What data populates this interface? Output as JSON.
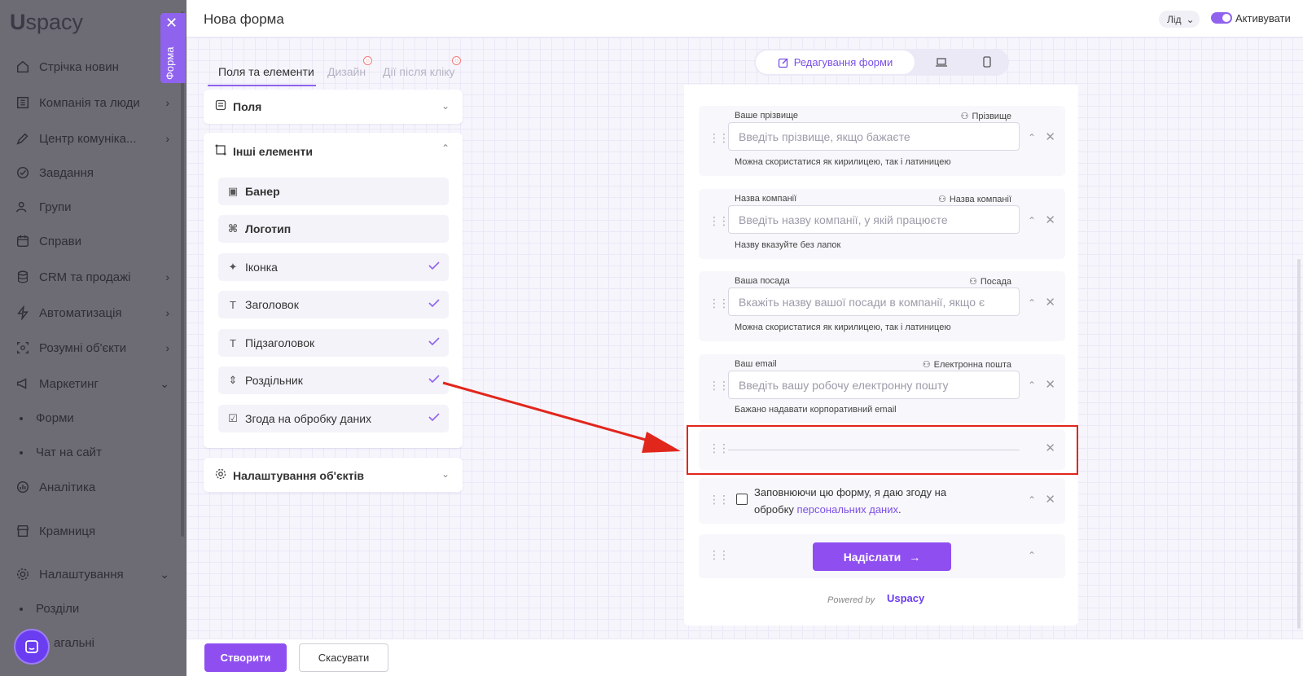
{
  "sidebar": {
    "logo_u": "U",
    "logo_rest": "spacy",
    "items": [
      {
        "label": "Стрічка новин",
        "icon": "home-icon"
      },
      {
        "label": "Компанія та люди",
        "icon": "building-icon"
      },
      {
        "label": "Центр комуніка...",
        "icon": "edit-icon"
      },
      {
        "label": "Завдання",
        "icon": "check-circle-icon"
      },
      {
        "label": "Групи",
        "icon": "users-icon"
      },
      {
        "label": "Справи",
        "icon": "calendar-icon"
      },
      {
        "label": "CRM та продажі",
        "icon": "database-icon"
      },
      {
        "label": "Автоматизація",
        "icon": "bolt-icon"
      },
      {
        "label": "Розумні об'єкти",
        "icon": "cube-icon"
      },
      {
        "label": "Маркетинг",
        "icon": "megaphone-icon"
      },
      {
        "label": "Аналітика",
        "icon": "chart-icon"
      },
      {
        "label": "Крамниця",
        "icon": "store-icon"
      },
      {
        "label": "Налаштування",
        "icon": "gear-icon"
      }
    ],
    "sub_items": [
      "Форми",
      "Чат на сайт",
      "Розділи",
      "агальні"
    ]
  },
  "forma_tab": {
    "label": "Форма"
  },
  "header": {
    "title": "Нова форма",
    "lead_select": "Лід",
    "activate_label": "Активувати"
  },
  "left_tabs": [
    "Поля та елементи",
    "Дизайн",
    "Дії після кліку"
  ],
  "panels": {
    "fields": "Поля",
    "other_elements": "Інші елементи",
    "object_settings": "Налаштування об'єктів"
  },
  "elements": [
    {
      "label": "Банер",
      "icon": "image-icon",
      "checked": false
    },
    {
      "label": "Логотип",
      "icon": "command-icon",
      "checked": false
    },
    {
      "label": "Іконка",
      "icon": "magic-wand-icon",
      "checked": true
    },
    {
      "label": "Заголовок",
      "icon": "text-icon",
      "checked": true
    },
    {
      "label": "Підзаголовок",
      "icon": "text-icon",
      "checked": true
    },
    {
      "label": "Роздільник",
      "icon": "divider-icon",
      "checked": true
    },
    {
      "label": "Згода на обробку даних",
      "icon": "checkbox-icon",
      "checked": true
    }
  ],
  "mode_switch": {
    "active_label": "Редагування форми"
  },
  "form_fields": [
    {
      "label": "Ваше прізвище",
      "map": "Прізвище",
      "placeholder": "Введіть прізвище, якщо бажаєте",
      "hint": "Можна скористатися як кирилицею, так і латиницею"
    },
    {
      "label": "Назва компанії",
      "map": "Назва компанії",
      "placeholder": "Введіть назву компанії, у якій працюєте",
      "hint": "Назву вказуйте без лапок"
    },
    {
      "label": "Ваша посада",
      "map": "Посада",
      "placeholder": "Вкажіть назву вашої посади в компанії, якщо є",
      "hint": "Можна скористатися як кирилицею, так і латиницею"
    },
    {
      "label": "Ваш email",
      "map": "Електронна пошта",
      "placeholder": "Введіть вашу робочу електронну пошту",
      "hint": "Бажано надавати корпоративний email"
    }
  ],
  "consent": {
    "text_before": "Заповнюючи цю форму, я даю згоду на обробку ",
    "link": "персональних даних",
    "text_after": "."
  },
  "submit_label": "Надіслати",
  "powered_by": "Powered by",
  "powered_brand": "Uspacy",
  "footer": {
    "create": "Створити",
    "cancel": "Скасувати"
  }
}
